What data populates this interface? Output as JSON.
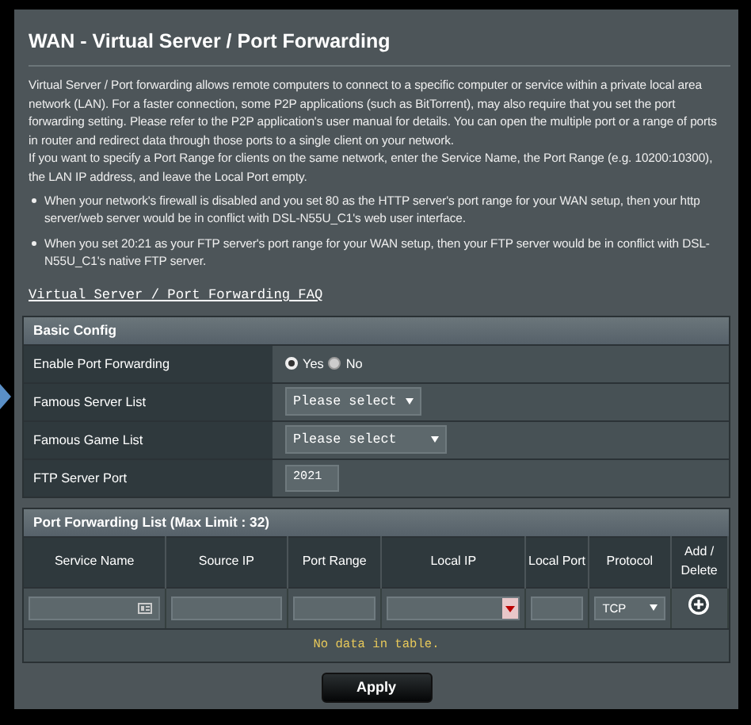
{
  "page": {
    "title": "WAN - Virtual Server / Port Forwarding",
    "intro": "Virtual Server / Port forwarding allows remote computers to connect to a specific computer or service within a private local area network (LAN). For a faster connection, some P2P applications (such as BitTorrent), may also require that you set the port forwarding setting. Please refer to the P2P application's user manual for details. You can open the multiple port or a range of ports in router and redirect data through those ports to a single client on your network.",
    "intro_2": "If you want to specify a Port Range for clients on the same network, enter the Service Name, the Port Range (e.g. 10200:10300), the LAN IP address, and leave the Local Port empty.",
    "notes": [
      "When your network's firewall is disabled and you set 80 as the HTTP server's port range for your WAN setup, then your http server/web server would be in conflict with DSL-N55U_C1's web user interface.",
      "When you set 20:21 as your FTP server's port range for your WAN setup, then your FTP server would be in conflict with DSL-N55U_C1's native FTP server."
    ],
    "faq_link": "Virtual Server / Port Forwarding FAQ"
  },
  "basic_config": {
    "title": "Basic Config",
    "rows": [
      {
        "kind": "radio",
        "label": "Enable Port Forwarding",
        "options": [
          {
            "label": "Yes",
            "selected": true
          },
          {
            "label": "No",
            "selected": false
          }
        ]
      },
      {
        "kind": "select",
        "label": "Famous Server List",
        "value": "Please select",
        "wide": false
      },
      {
        "kind": "select",
        "label": "Famous Game List",
        "value": "Please select",
        "wide": true
      },
      {
        "kind": "input",
        "label": "FTP Server Port",
        "value": "2021"
      }
    ]
  },
  "port_list": {
    "title": "Port Forwarding List (Max Limit : 32)",
    "columns": [
      "Service Name",
      "Source IP",
      "Port Range",
      "Local IP",
      "Local Port",
      "Protocol",
      "Add / Delete"
    ],
    "protocol": "TCP",
    "empty_message": "No data in table."
  },
  "apply_button": "Apply"
}
